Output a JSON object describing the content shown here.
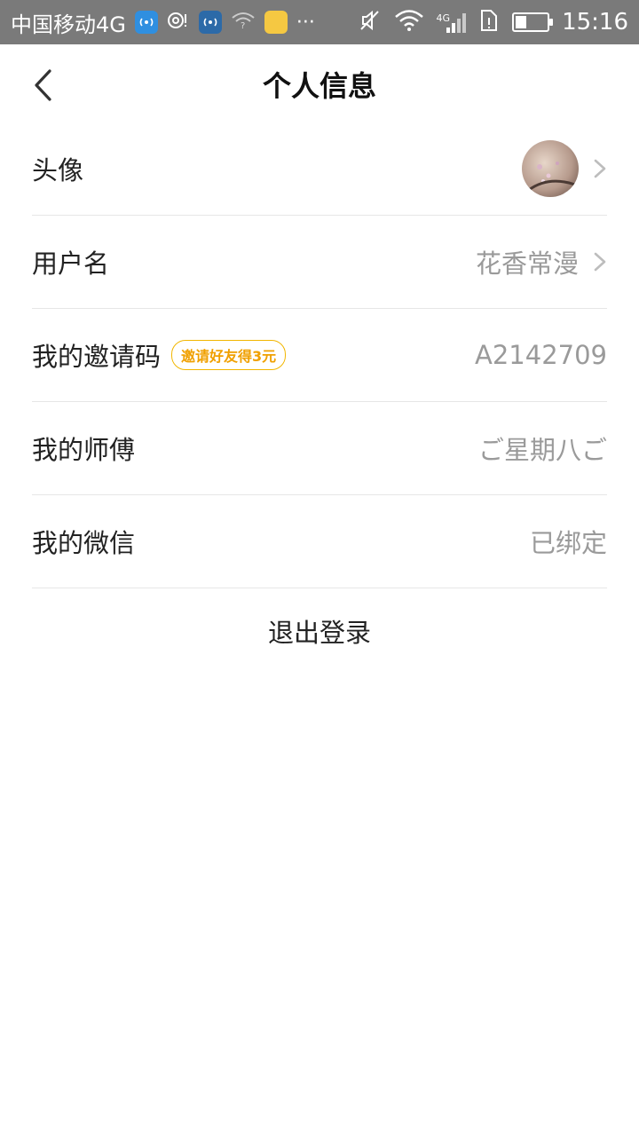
{
  "status_bar": {
    "carrier": "中国移动4G",
    "network_label": "4G",
    "time": "15:16",
    "battery_level": 0.35,
    "notification_icons": [
      "wifi-share-icon",
      "hotspot-icon",
      "wifi-share-icon",
      "wifi-question-icon",
      "app-yellow-icon",
      "more-dots-icon"
    ]
  },
  "header": {
    "title": "个人信息"
  },
  "rows": {
    "avatar": {
      "label": "头像"
    },
    "username": {
      "label": "用户名",
      "value": "花香常漫"
    },
    "invite_code": {
      "label": "我的邀请码",
      "badge": "邀请好友得3元",
      "value": "A2142709"
    },
    "master": {
      "label": "我的师傅",
      "value": "ご星期八ご"
    },
    "wechat": {
      "label": "我的微信",
      "value": "已绑定"
    }
  },
  "logout": {
    "label": "退出登录"
  },
  "colors": {
    "status_bar_bg": "#7a7a7a",
    "badge": "#f0a000",
    "value_text": "#9a9a9a",
    "divider": "#e6e6e6"
  }
}
